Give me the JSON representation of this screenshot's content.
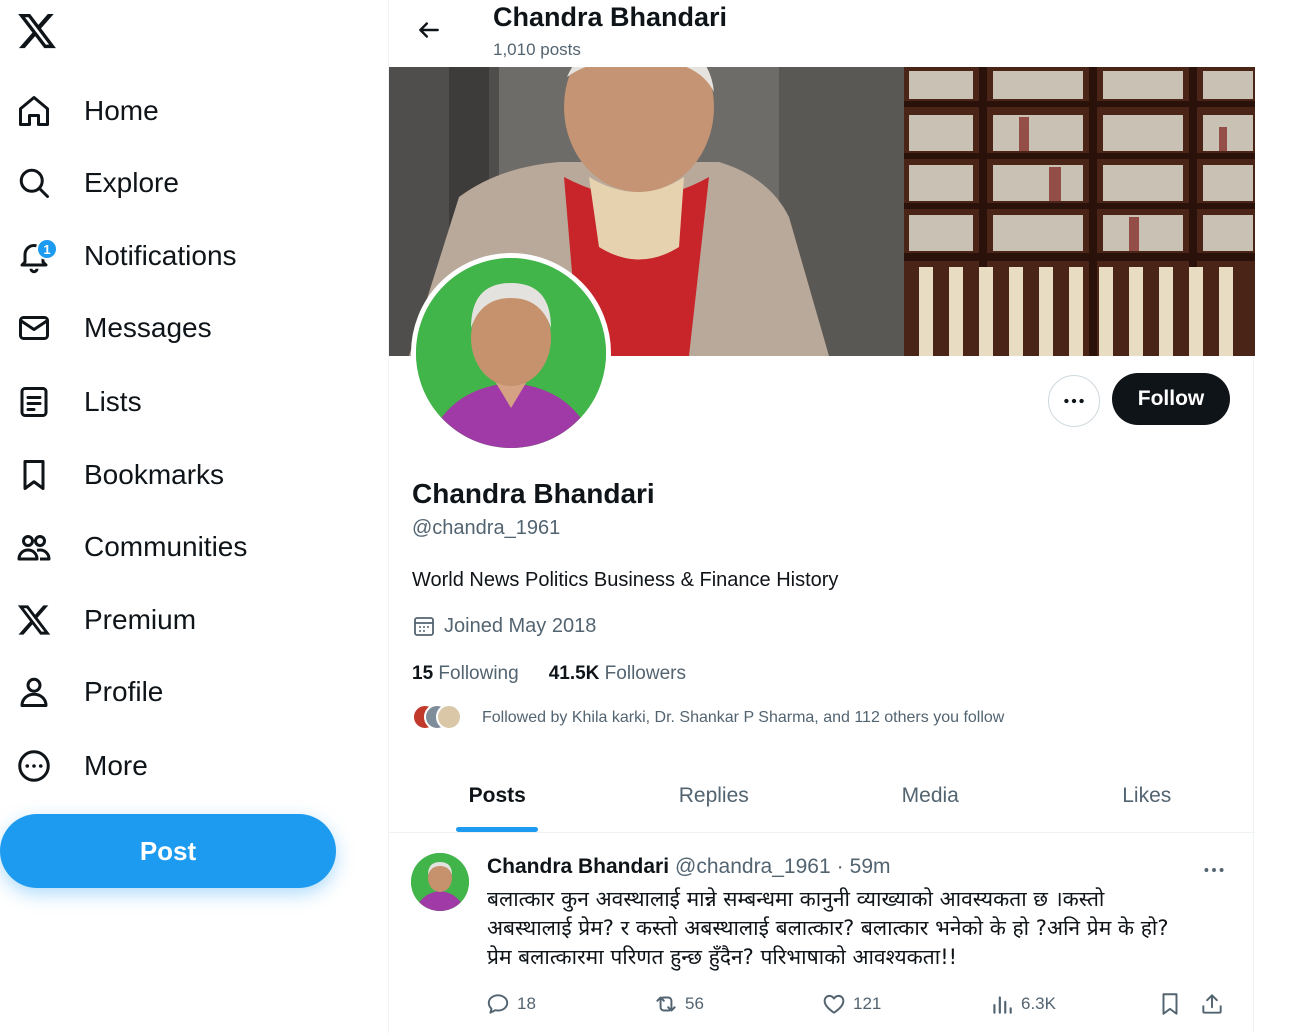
{
  "sidebar": {
    "items": [
      {
        "label": "Home",
        "icon": "home-icon"
      },
      {
        "label": "Explore",
        "icon": "search-icon"
      },
      {
        "label": "Notifications",
        "icon": "bell-icon",
        "badge": "1"
      },
      {
        "label": "Messages",
        "icon": "mail-icon"
      },
      {
        "label": "Lists",
        "icon": "list-icon"
      },
      {
        "label": "Bookmarks",
        "icon": "bookmark-icon"
      },
      {
        "label": "Communities",
        "icon": "people-icon"
      },
      {
        "label": "Premium",
        "icon": "x-logo-icon"
      },
      {
        "label": "Profile",
        "icon": "person-icon"
      },
      {
        "label": "More",
        "icon": "more-circle-icon"
      }
    ],
    "post_label": "Post",
    "accent": "#1d9bf0"
  },
  "header": {
    "name": "Chandra Bhandari",
    "post_count": "1,010 posts"
  },
  "profile": {
    "name": "Chandra Bhandari",
    "handle": "@chandra_1961",
    "bio": "World News Politics Business & Finance History",
    "joined": "Joined May 2018",
    "following_count": "15",
    "following_label": "Following",
    "followers_count": "41.5K",
    "followers_label": "Followers",
    "followed_by": "Followed by Khila karki, Dr. Shankar P Sharma, and 112 others you follow",
    "follow_label": "Follow"
  },
  "tabs": [
    {
      "label": "Posts",
      "active": true
    },
    {
      "label": "Replies",
      "active": false
    },
    {
      "label": "Media",
      "active": false
    },
    {
      "label": "Likes",
      "active": false
    }
  ],
  "tweet": {
    "name": "Chandra Bhandari",
    "handle": "@chandra_1961",
    "separator": "·",
    "time": "59m",
    "text_lines": [
      "बलात्कार कुन अवस्थालाई मान्ने सम्बन्धमा कानुनी व्याख्याको आवस्यकता छ ।कस्तो",
      "अबस्थालाई प्रेम? र कस्तो अबस्थालाई बलात्कार? बलात्कार भनेको के हो ?अनि प्रेम के हो?",
      "प्रेम बलात्कारमा परिणत हुन्छ हुँदैन? परिभाषाको आवश्यकता!!"
    ],
    "replies": "18",
    "reposts": "56",
    "likes": "121",
    "views": "6.3K"
  }
}
